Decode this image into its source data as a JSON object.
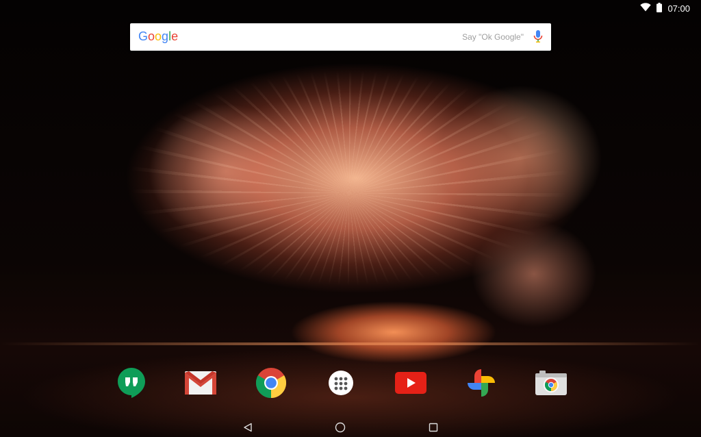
{
  "status_bar": {
    "time": "07:00",
    "icons": [
      "wifi-icon",
      "battery-icon"
    ]
  },
  "search": {
    "logo_letters": [
      "G",
      "o",
      "o",
      "g",
      "l",
      "e"
    ],
    "logo_colors": [
      "#4285F4",
      "#EA4335",
      "#FBBC05",
      "#4285F4",
      "#34A853",
      "#EA4335"
    ],
    "hint": "Say \"Ok Google\"",
    "icon": "mic-icon"
  },
  "dock": {
    "apps": [
      {
        "name": "Hangouts",
        "icon": "hangouts-icon"
      },
      {
        "name": "Gmail",
        "icon": "gmail-icon"
      },
      {
        "name": "Chrome",
        "icon": "chrome-icon"
      },
      {
        "name": "Apps",
        "icon": "app-drawer-icon"
      },
      {
        "name": "YouTube",
        "icon": "youtube-icon"
      },
      {
        "name": "Photos",
        "icon": "photos-icon"
      },
      {
        "name": "Camera",
        "icon": "camera-icon"
      }
    ]
  },
  "navigation": {
    "buttons": [
      "back-icon",
      "home-icon",
      "recents-icon"
    ]
  },
  "colors": {
    "google_blue": "#4285F4",
    "google_red": "#EA4335",
    "google_yellow": "#FBBC05",
    "google_green": "#34A853",
    "hangouts_green": "#0F9D58",
    "youtube_red": "#E62117"
  }
}
